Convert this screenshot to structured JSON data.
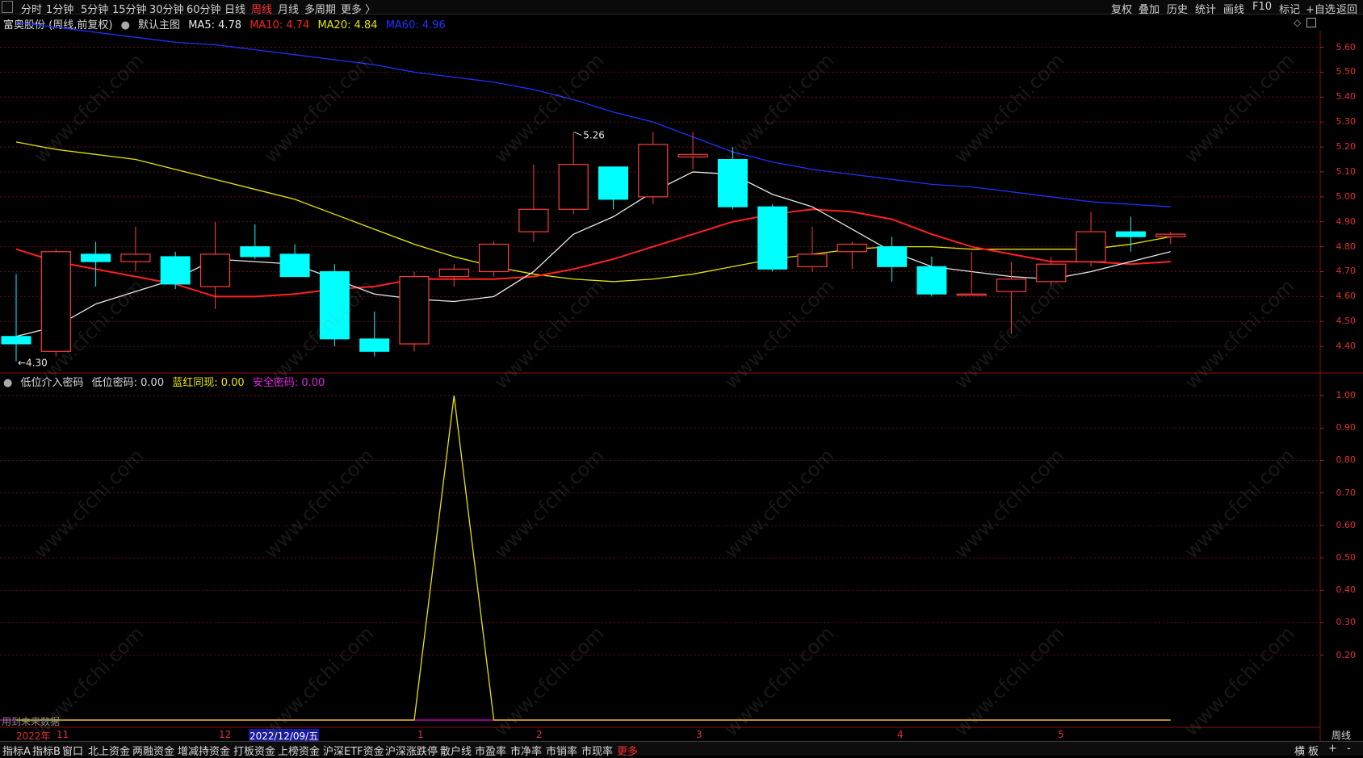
{
  "toolbar": {
    "periods": [
      "分时",
      "1分钟",
      "5分钟",
      "15分钟",
      "30分钟",
      "60分钟",
      "日线",
      "周线",
      "月线",
      "多周期",
      "更多 〉"
    ],
    "active_period": "周线",
    "right_tools": [
      "复权",
      "叠加",
      "历史",
      "统计",
      "画线",
      "F10",
      "标记",
      "+自选",
      "返回"
    ]
  },
  "main": {
    "stock_title": "富奥股份 (周线,前复权)",
    "template": "默认主图",
    "ma5": "MA5: 4.78",
    "ma10": "MA10: 4.74",
    "ma20": "MA20: 4.84",
    "ma60": "MA60: 4.96",
    "high_label": "5.26",
    "low_label": "←4.30",
    "y_ticks": [
      "5.60",
      "5.50",
      "5.40",
      "5.30",
      "5.20",
      "5.10",
      "5.00",
      "4.90",
      "4.80",
      "4.70",
      "4.60",
      "4.50",
      "4.40"
    ]
  },
  "indicator": {
    "name": "低位介入密码",
    "v1": "低位密码: 0.00",
    "v2": "蓝红同现: 0.00",
    "v3": "安全密码: 0.00",
    "y_ticks": [
      "1.00",
      "0.90",
      "0.80",
      "0.70",
      "0.60",
      "0.50",
      "0.40",
      "0.30",
      "0.20"
    ],
    "future_note": "用到未来数据"
  },
  "date_axis": {
    "year": "2022年",
    "months": [
      "11",
      "12",
      "1",
      "2",
      "3",
      "4",
      "5"
    ],
    "cursor_date": "2022/12/09/五",
    "period_label": "周线"
  },
  "bottom_tabs": [
    "指标A",
    "指标B",
    "窗口",
    "北上资金",
    "两融资金",
    "增减持资金",
    "打板资金",
    "上榜资金",
    "沪深ETF资金",
    "沪深涨跌停",
    "散户线",
    "市盈率",
    "市净率",
    "市销率",
    "市现率",
    "更多"
  ],
  "bottom_right": [
    "横",
    "板",
    "+",
    "-"
  ],
  "watermark_text": "www.cfchi.com",
  "colors": {
    "up": "#ff3c3c",
    "down": "#00ffff",
    "ma5": "#e8e8e8",
    "ma10": "#ff2020",
    "ma20": "#e6e600",
    "ma60": "#2030ff",
    "indicator": "#e6e600",
    "baseline": "#c000c0"
  },
  "chart_data": {
    "type": "candlestick",
    "unit": "CNY",
    "candles": [
      {
        "o": 4.44,
        "h": 4.69,
        "l": 4.34,
        "c": 4.41
      },
      {
        "o": 4.38,
        "h": 4.79,
        "l": 4.36,
        "c": 4.78
      },
      {
        "o": 4.77,
        "h": 4.82,
        "l": 4.64,
        "c": 4.74
      },
      {
        "o": 4.74,
        "h": 4.88,
        "l": 4.7,
        "c": 4.77
      },
      {
        "o": 4.76,
        "h": 4.78,
        "l": 4.63,
        "c": 4.65
      },
      {
        "o": 4.64,
        "h": 4.9,
        "l": 4.55,
        "c": 4.77
      },
      {
        "o": 4.8,
        "h": 4.89,
        "l": 4.75,
        "c": 4.76
      },
      {
        "o": 4.77,
        "h": 4.81,
        "l": 4.68,
        "c": 4.68
      },
      {
        "o": 4.7,
        "h": 4.73,
        "l": 4.4,
        "c": 4.43
      },
      {
        "o": 4.43,
        "h": 4.54,
        "l": 4.36,
        "c": 4.38
      },
      {
        "o": 4.41,
        "h": 4.7,
        "l": 4.38,
        "c": 4.68
      },
      {
        "o": 4.68,
        "h": 4.73,
        "l": 4.64,
        "c": 4.71
      },
      {
        "o": 4.7,
        "h": 4.82,
        "l": 4.68,
        "c": 4.81
      },
      {
        "o": 4.86,
        "h": 5.13,
        "l": 4.82,
        "c": 4.95
      },
      {
        "o": 4.95,
        "h": 5.26,
        "l": 4.93,
        "c": 5.13
      },
      {
        "o": 5.12,
        "h": 5.12,
        "l": 4.95,
        "c": 4.99
      },
      {
        "o": 5.0,
        "h": 5.26,
        "l": 4.97,
        "c": 5.21
      },
      {
        "o": 5.16,
        "h": 5.26,
        "l": 5.11,
        "c": 5.17
      },
      {
        "o": 5.15,
        "h": 5.2,
        "l": 4.95,
        "c": 4.96
      },
      {
        "o": 4.96,
        "h": 4.97,
        "l": 4.7,
        "c": 4.71
      },
      {
        "o": 4.72,
        "h": 4.88,
        "l": 4.7,
        "c": 4.77
      },
      {
        "o": 4.78,
        "h": 4.82,
        "l": 4.71,
        "c": 4.81
      },
      {
        "o": 4.8,
        "h": 4.84,
        "l": 4.66,
        "c": 4.72
      },
      {
        "o": 4.72,
        "h": 4.76,
        "l": 4.6,
        "c": 4.61
      },
      {
        "o": 4.61,
        "h": 4.78,
        "l": 4.61,
        "c": 4.61
      },
      {
        "o": 4.62,
        "h": 4.74,
        "l": 4.45,
        "c": 4.67
      },
      {
        "o": 4.66,
        "h": 4.76,
        "l": 4.64,
        "c": 4.73
      },
      {
        "o": 4.74,
        "h": 4.94,
        "l": 4.72,
        "c": 4.86
      },
      {
        "o": 4.86,
        "h": 4.92,
        "l": 4.78,
        "c": 4.84
      },
      {
        "o": 4.84,
        "h": 4.86,
        "l": 4.81,
        "c": 4.85
      }
    ],
    "ma5": [
      4.44,
      4.48,
      4.57,
      4.62,
      4.67,
      4.75,
      4.74,
      4.73,
      4.67,
      4.61,
      4.59,
      4.58,
      4.6,
      4.7,
      4.85,
      4.92,
      5.02,
      5.1,
      5.09,
      5.01,
      4.96,
      4.87,
      4.78,
      4.72,
      4.7,
      4.68,
      4.67,
      4.7,
      4.74,
      4.78
    ],
    "ma10": [
      4.79,
      4.74,
      4.71,
      4.68,
      4.65,
      4.6,
      4.6,
      4.61,
      4.63,
      4.64,
      4.67,
      4.67,
      4.67,
      4.68,
      4.71,
      4.75,
      4.8,
      4.85,
      4.9,
      4.93,
      4.95,
      4.94,
      4.91,
      4.85,
      4.8,
      4.77,
      4.74,
      4.74,
      4.73,
      4.74
    ],
    "ma20": [
      5.22,
      5.19,
      5.17,
      5.15,
      5.11,
      5.07,
      5.03,
      4.99,
      4.93,
      4.87,
      4.81,
      4.76,
      4.72,
      4.69,
      4.67,
      4.66,
      4.67,
      4.69,
      4.72,
      4.75,
      4.77,
      4.79,
      4.8,
      4.8,
      4.79,
      4.79,
      4.79,
      4.79,
      4.81,
      4.84
    ],
    "ma60": [
      5.7,
      5.68,
      5.66,
      5.64,
      5.62,
      5.61,
      5.59,
      5.57,
      5.55,
      5.53,
      5.5,
      5.48,
      5.46,
      5.43,
      5.39,
      5.34,
      5.3,
      5.24,
      5.18,
      5.14,
      5.11,
      5.09,
      5.07,
      5.05,
      5.04,
      5.02,
      5.0,
      4.98,
      4.97,
      4.96
    ],
    "indicator_values": [
      0,
      0,
      0,
      0,
      0,
      0,
      0,
      0,
      0,
      0,
      0,
      1,
      0,
      0,
      0,
      0,
      0,
      0,
      0,
      0,
      0,
      0,
      0,
      0,
      0,
      0,
      0,
      0,
      0,
      0
    ],
    "ylim_main": [
      4.3,
      5.66
    ],
    "ylim_indicator": [
      0,
      1.05
    ]
  }
}
